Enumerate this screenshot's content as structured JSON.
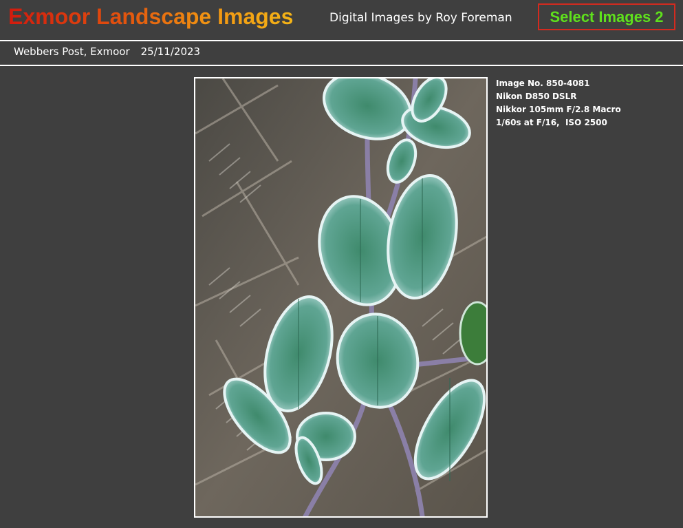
{
  "header": {
    "site_title": "Exmoor Landscape Images",
    "author": "Digital Images by Roy Foreman",
    "select_button": "Select Images 2"
  },
  "subheader": {
    "location": "Webbers Post, Exmoor",
    "date": "25/11/2023"
  },
  "image_info": {
    "image_number": "Image No. 850-4081",
    "camera": "Nikon D850 DSLR",
    "lens": "Nikkor 105mm F/2.8 Macro",
    "exposure": "1/60s at F/16,  ISO 2500"
  },
  "colors": {
    "background": "#3f3f3f",
    "title_gradient_start": "#d21b0e",
    "title_gradient_end": "#f4b417",
    "button_text": "#5fe01c",
    "button_border": "#d42a1f"
  }
}
